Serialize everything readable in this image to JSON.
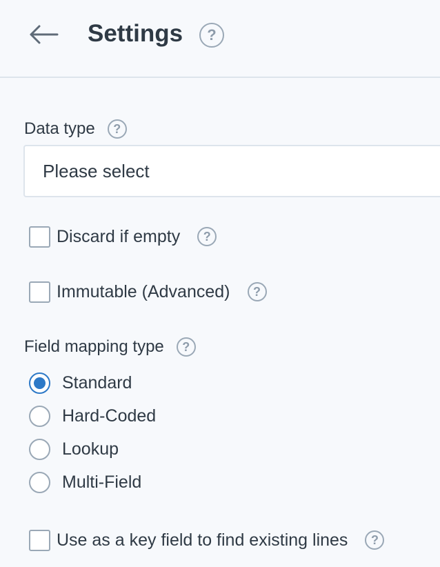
{
  "header": {
    "title": "Settings",
    "help": "?"
  },
  "data_type": {
    "label": "Data type",
    "help": "?",
    "selected": "Please select"
  },
  "discard_if_empty": {
    "label": "Discard if empty",
    "help": "?",
    "checked": false
  },
  "immutable": {
    "label": "Immutable (Advanced)",
    "help": "?",
    "checked": false
  },
  "field_mapping": {
    "label": "Field mapping type",
    "help": "?",
    "options": [
      {
        "label": "Standard",
        "checked": true
      },
      {
        "label": "Hard-Coded",
        "checked": false
      },
      {
        "label": "Lookup",
        "checked": false
      },
      {
        "label": "Multi-Field",
        "checked": false
      }
    ]
  },
  "key_field": {
    "label": "Use as a key field to find existing lines",
    "help": "?",
    "checked": false
  },
  "colors": {
    "accent": "#2d79c7",
    "text": "#2f3a45",
    "muted": "#9aa8b6",
    "background": "#f7f9fc"
  }
}
